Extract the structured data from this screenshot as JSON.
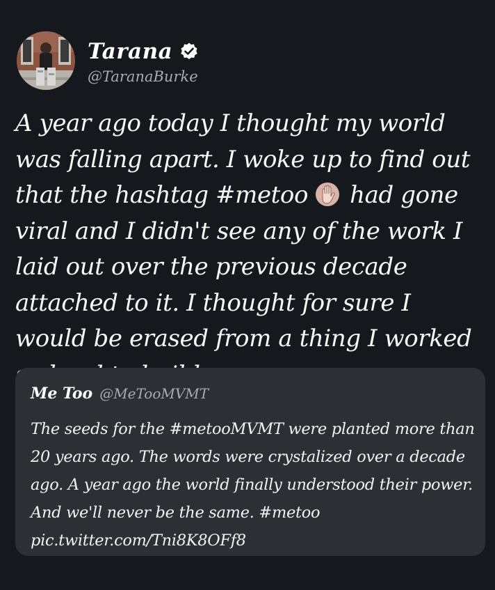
{
  "author": {
    "display_name": "Tarana",
    "handle": "@TaranaBurke",
    "verified": true
  },
  "tweet": {
    "text_before_hashtag": "A year ago today I thought my world was falling apart. I woke up to find out that the hashtag ",
    "hashtag": "#metoo",
    "emoji": "raised-hand-emoji",
    "text_after_hashtag": "had gone viral and I didn't see any of the work I laid out over the previous decade attached to it. I thought for sure I would be erased from a thing I worked so hard to build. +"
  },
  "quoted_tweet": {
    "display_name": "Me Too",
    "handle": "@MeTooMVMT",
    "text": "The seeds for the #metooMVMT were planted more than 20 years ago. The words were crystalized over a decade ago. A year ago the world finally understood their power. And we'll never be the same. #metoo pic.twitter.com/Tni8K8OFf8"
  },
  "colors": {
    "background": "#15181c",
    "quote_card": "#2c3035",
    "verified_badge": "#ffffff",
    "secondary_text": "#a8acb2"
  }
}
